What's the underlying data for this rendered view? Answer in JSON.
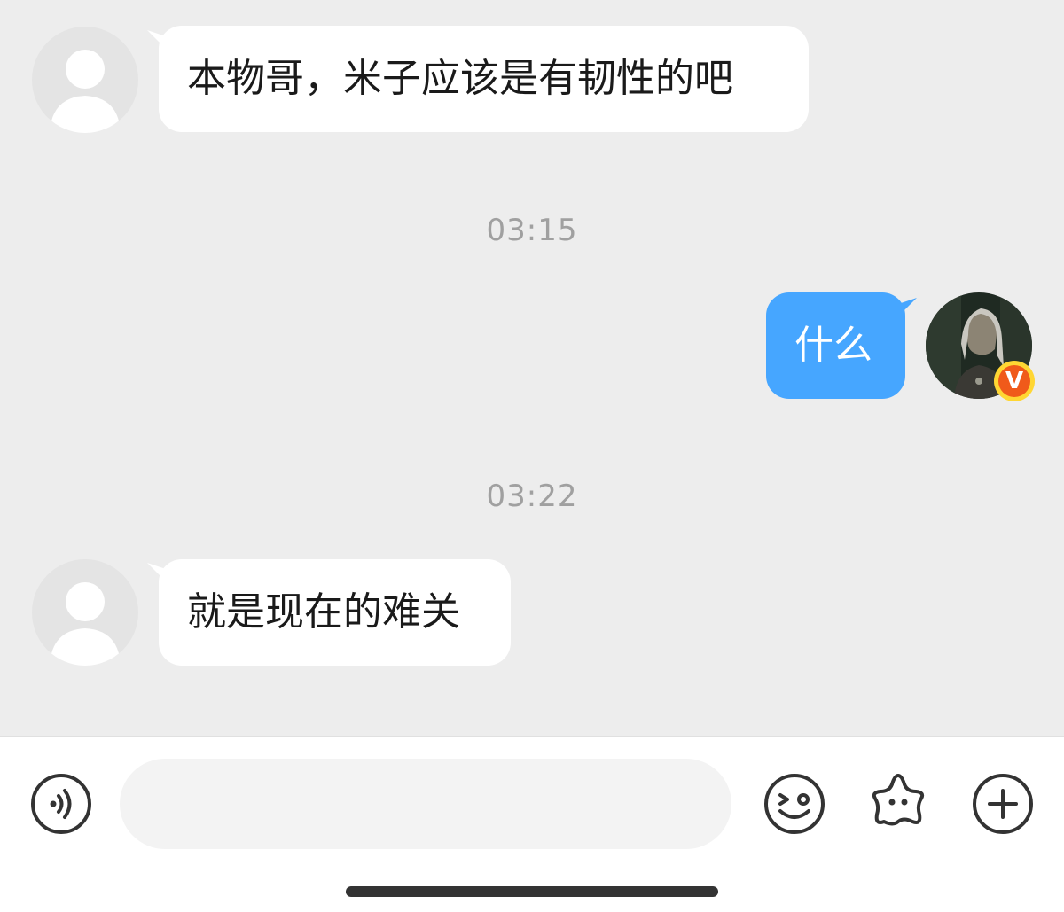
{
  "messages": [
    {
      "side": "incoming",
      "text": "本物哥，米子应该是有韧性的吧"
    },
    {
      "side": "outgoing",
      "text": "什么"
    },
    {
      "side": "incoming",
      "text": "就是现在的难关"
    }
  ],
  "timestamps": [
    "03:15",
    "03:22"
  ],
  "badge": {
    "letter": "V"
  },
  "composer": {
    "placeholder": ""
  },
  "icons": {
    "voice": "voice-icon",
    "emoji": "emoji-icon",
    "sticker": "sticker-icon",
    "more": "plus-icon",
    "avatar_default": "default-avatar-icon"
  },
  "colors": {
    "background": "#ededed",
    "incoming_bubble": "#ffffff",
    "outgoing_bubble": "#46a6ff",
    "timestamp": "#a0a0a0",
    "badge": "#f05a1a"
  }
}
